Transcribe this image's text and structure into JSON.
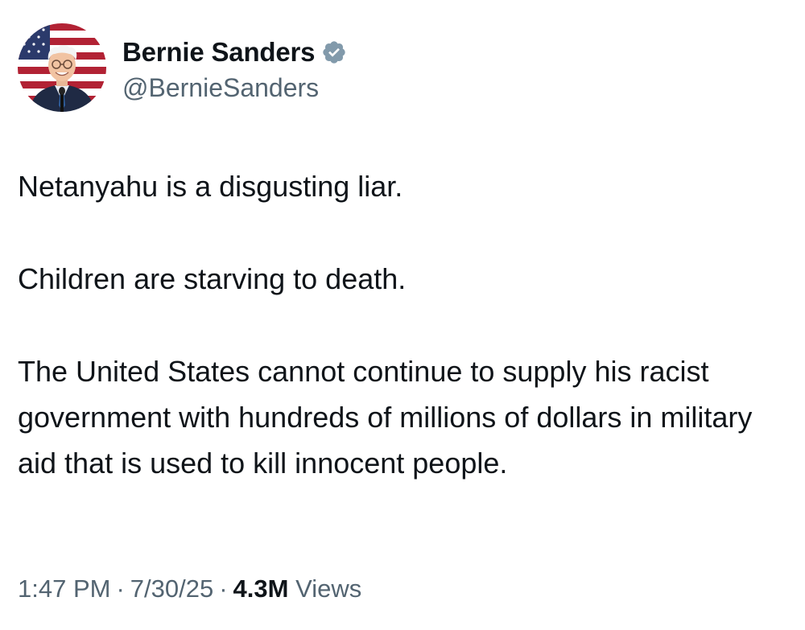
{
  "author": {
    "display_name": "Bernie Sanders",
    "handle": "@BernieSanders",
    "verified": true,
    "verified_icon": "verified-badge-icon"
  },
  "tweet": {
    "paragraphs": [
      "Netanyahu is a disgusting liar.",
      "Children are starving to death.",
      "The United States cannot continue to supply his racist government with hundreds of millions of dollars in military aid that is used to kill innocent people."
    ]
  },
  "meta": {
    "time": "1:47 PM",
    "separator": "·",
    "date": "7/30/25",
    "views_count": "4.3M",
    "views_label": "Views"
  },
  "colors": {
    "text": "#0f1419",
    "secondary": "#536471",
    "verified_badge": "#829aab"
  }
}
